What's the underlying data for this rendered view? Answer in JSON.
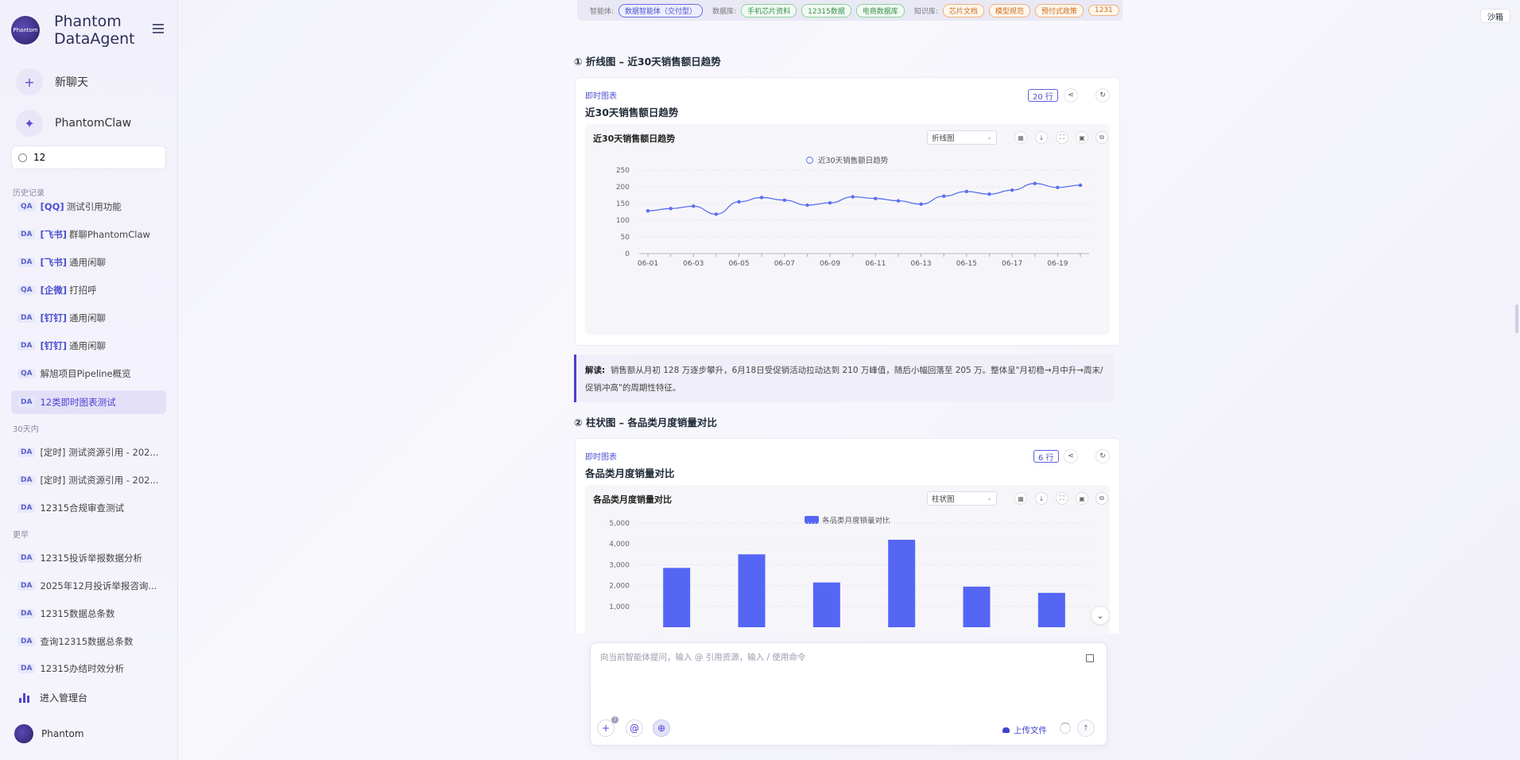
{
  "app": {
    "brand_line1": "Phantom",
    "brand_line2": "DataAgent",
    "logo_text": "Phantom"
  },
  "sidebar": {
    "new_chat": "新聊天",
    "claw": "PhantomClaw",
    "search_value": "12",
    "section_history": "历史记录",
    "section_30days": "30天内",
    "section_earlier": "更早",
    "history": [
      {
        "badge": "QA",
        "tag": "[QQ]",
        "text": "测试引用功能"
      },
      {
        "badge": "DA",
        "tag": "[飞书]",
        "text": "群聊PhantomClaw"
      },
      {
        "badge": "DA",
        "tag": "[飞书]",
        "text": "通用闲聊"
      },
      {
        "badge": "QA",
        "tag": "[企微]",
        "text": "打招呼"
      },
      {
        "badge": "DA",
        "tag": "[钉钉]",
        "text": "通用闲聊"
      },
      {
        "badge": "DA",
        "tag": "[钉钉]",
        "text": "通用闲聊"
      },
      {
        "badge": "QA",
        "tag": "",
        "text": "解旭项目Pipeline概览"
      },
      {
        "badge": "DA",
        "tag": "",
        "text": "12类即时图表测试"
      }
    ],
    "thirty_days": [
      {
        "badge": "DA",
        "text": "[定时] 测试资源引用 - 202..."
      },
      {
        "badge": "DA",
        "text": "[定时] 测试资源引用 - 202..."
      },
      {
        "badge": "DA",
        "text": "12315合规审查测试"
      }
    ],
    "earlier": [
      {
        "badge": "DA",
        "text": "12315投诉举报数据分析"
      },
      {
        "badge": "DA",
        "text": "2025年12月投诉举报咨询..."
      },
      {
        "badge": "DA",
        "text": "12315数据总条数"
      },
      {
        "badge": "DA",
        "text": "查询12315数据总条数"
      },
      {
        "badge": "DA",
        "text": "12315办结时效分析"
      }
    ],
    "admin": "进入管理台",
    "user": "Phantom"
  },
  "filterbar": {
    "agent_label": "智能体:",
    "agent_chip": "数据智能体（交付型）",
    "db_label": "数据库:",
    "db_chips": [
      "手机芯片资料",
      "12315数据",
      "电商数据库"
    ],
    "kb_label": "知识库:",
    "kb_chips": [
      "芯片文档",
      "模型规范",
      "预付式政策",
      "1231"
    ],
    "sandbox": "沙箱"
  },
  "sections": [
    {
      "heading": "① 折线图 – 近30天销售额日趋势",
      "kicker": "即时图表",
      "title": "近30天销售额日趋势",
      "rows": "20 行",
      "inner_title": "近30天销售额日趋势",
      "chart_type_select": "折线图"
    },
    {
      "heading": "② 柱状图 – 各品类月度销量对比",
      "kicker": "即时图表",
      "title": "各品类月度销量对比",
      "rows": "6 行",
      "inner_title": "各品类月度销量对比",
      "chart_type_select": "柱状图"
    }
  ],
  "note": {
    "label": "解读:",
    "text": "销售额从月初 128 万逐步攀升，6月18日受促销活动拉动达到 210 万峰值，随后小幅回落至 205 万。整体呈\"月初稳→月中升→周末/促销冲高\"的周期性特征。"
  },
  "composer": {
    "placeholder": "向当前智能体提问，输入 @ 引用资源，输入 / 使用命令",
    "upload": "上传文件",
    "plus_badge": "7"
  },
  "chart_data": [
    {
      "type": "line",
      "title": "近30天销售额日趋势",
      "series": [
        {
          "name": "近30天销售额日趋势",
          "color": "#5b6ef0",
          "values": [
            128,
            135,
            142,
            118,
            155,
            168,
            160,
            145,
            152,
            170,
            165,
            158,
            148,
            172,
            186,
            178,
            190,
            210,
            198,
            205
          ]
        }
      ],
      "x": [
        "06-01",
        "06-02",
        "06-03",
        "06-04",
        "06-05",
        "06-06",
        "06-07",
        "06-08",
        "06-09",
        "06-10",
        "06-11",
        "06-12",
        "06-13",
        "06-14",
        "06-15",
        "06-16",
        "06-17",
        "06-18",
        "06-19",
        "06-20"
      ],
      "xtick_labels": [
        "06-01",
        "06-03",
        "06-05",
        "06-07",
        "06-09",
        "06-11",
        "06-13",
        "06-15",
        "06-17",
        "06-19"
      ],
      "ylim": [
        0,
        250
      ],
      "yticks": [
        0,
        50,
        100,
        150,
        200,
        250
      ],
      "grid": true,
      "legend": "top"
    },
    {
      "type": "bar",
      "title": "各品类月度销量对比",
      "series": [
        {
          "name": "各品类月度销量对比",
          "color": "#5566f5",
          "values": [
            2850,
            3500,
            2150,
            4200,
            1950,
            1650
          ]
        }
      ],
      "yticks": [
        1000,
        2000,
        3000,
        4000,
        5000
      ],
      "ytick_labels": [
        "1,000",
        "2,000",
        "3,000",
        "4,000",
        "5,000"
      ],
      "ylim": [
        0,
        5000
      ],
      "grid": true,
      "legend": "top"
    }
  ],
  "colors": {
    "accent": "#4c3fcf",
    "series": "#5b6ef0"
  }
}
